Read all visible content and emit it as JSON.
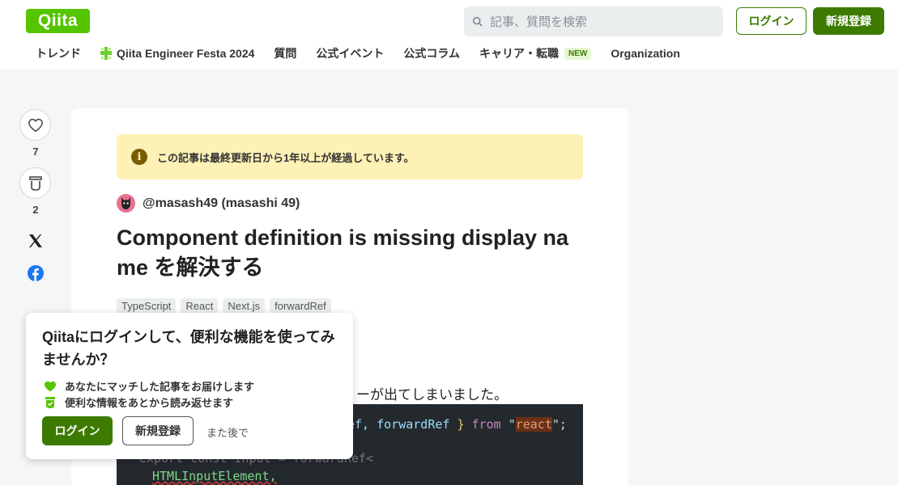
{
  "header": {
    "logo": "Qiita",
    "search_placeholder": "記事、質問を検索",
    "login_label": "ログイン",
    "signup_label": "新規登録"
  },
  "nav": {
    "items": [
      {
        "label": "トレンド"
      },
      {
        "label": "Qiita Engineer Festa 2024"
      },
      {
        "label": "質問"
      },
      {
        "label": "公式イベント"
      },
      {
        "label": "公式コラム"
      },
      {
        "label": "キャリア・転職",
        "badge": "NEW"
      },
      {
        "label": "Organization"
      }
    ]
  },
  "side": {
    "like_count": "7",
    "stock_count": "2"
  },
  "article": {
    "notice": "この記事は最終更新日から1年以上が経過しています。",
    "author": "@masash49 (masashi 49)",
    "title": "Component definition is missing display name を解決する",
    "tags": [
      "TypeScript",
      "React",
      "Next.js",
      "forwardRef"
    ],
    "body_text": "ーが出てしまいました。",
    "code": {
      "line1_a": "ef,",
      "line1_b": "forwardRef",
      "line1_c": "}",
      "line1_d": "from",
      "line1_str": "react",
      "line2": "export const Input = forwardRef<",
      "line3": "HTMLInputElement,"
    }
  },
  "popup": {
    "title": "Qiitaにログインして、便利な機能を使ってみませんか？",
    "benefit1": "あなたにマッチした記事をお届けします",
    "benefit2": "便利な情報をあとから読み返せます",
    "login_label": "ログイン",
    "signup_label": "新規登録",
    "later_label": "また後で"
  }
}
